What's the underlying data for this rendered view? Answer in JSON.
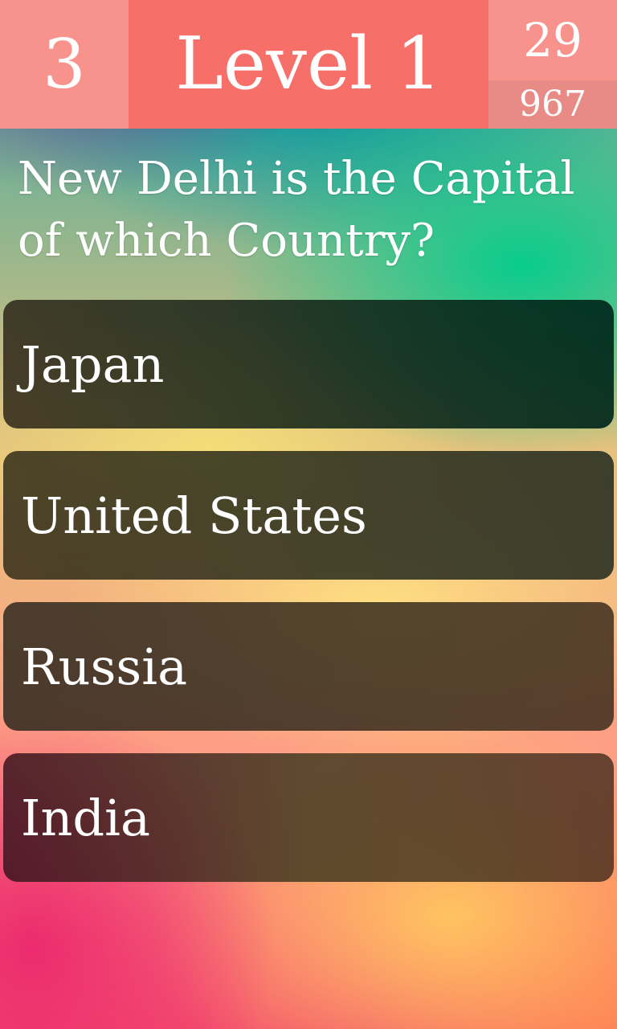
{
  "header": {
    "lives": "3",
    "level_label": "Level 1",
    "timer": "29",
    "score": "967"
  },
  "question": {
    "text": "New Delhi is the Capital of which Country?"
  },
  "answers": [
    {
      "label": "Japan"
    },
    {
      "label": "United States"
    },
    {
      "label": "Russia"
    },
    {
      "label": "India"
    }
  ],
  "colors": {
    "header_lives_bg": "#f7928c",
    "header_level_bg": "#f66f69",
    "header_score_bg": "#e88b87",
    "answer_bg": "#2a221a"
  }
}
